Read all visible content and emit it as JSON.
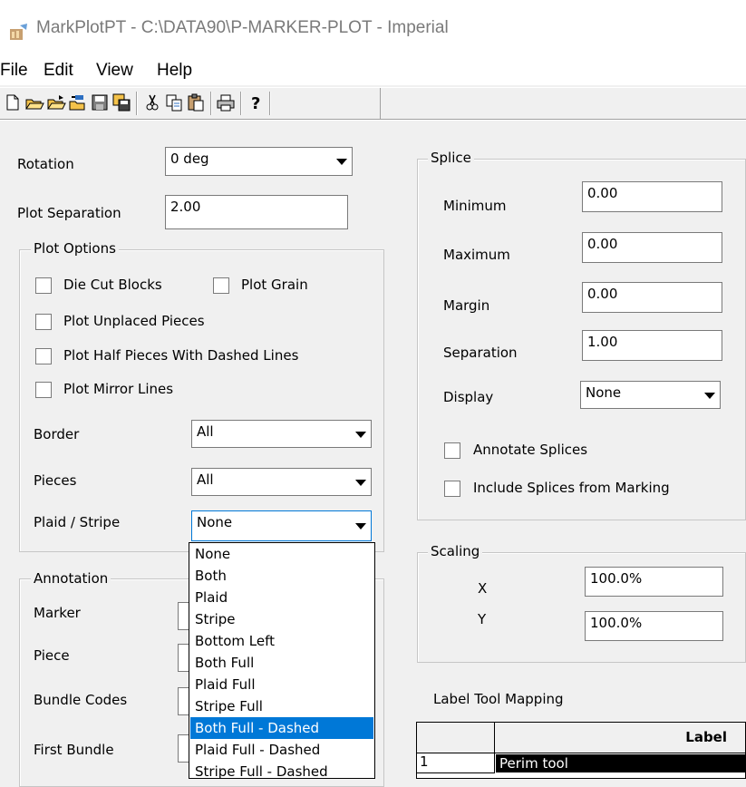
{
  "window": {
    "title": "MarkPlotPT - C:\\DATA90\\P-MARKER-PLOT - Imperial",
    "icon": "chart-app-icon"
  },
  "menu": [
    "File",
    "Edit",
    "View",
    "Help"
  ],
  "toolbar": {
    "buttons": [
      "new-icon",
      "open-icon",
      "open-folder-icon",
      "import-icon",
      "save-icon",
      "save-all-icon",
      "cut-icon",
      "copy-icon",
      "paste-icon",
      "print-icon",
      "help-icon"
    ]
  },
  "left": {
    "rotation_label": "Rotation",
    "rotation_value": "0 deg",
    "plot_separation_label": "Plot Separation",
    "plot_separation_value": "2.00",
    "plot_options": {
      "title": "Plot Options",
      "die_cut_blocks": "Die Cut Blocks",
      "plot_grain": "Plot Grain",
      "plot_unplaced": "Plot Unplaced Pieces",
      "plot_half": "Plot Half Pieces With Dashed Lines",
      "plot_mirror": "Plot Mirror Lines",
      "border_label": "Border",
      "border_value": "All",
      "pieces_label": "Pieces",
      "pieces_value": "All",
      "plaid_label": "Plaid / Stripe",
      "plaid_value": "None"
    },
    "annotation": {
      "title": "Annotation",
      "marker": "Marker",
      "piece": "Piece",
      "bundle_codes": "Bundle Codes",
      "first_bundle": "First Bundle"
    }
  },
  "dropdown": {
    "options": [
      "None",
      "Both",
      "Plaid",
      "Stripe",
      "Bottom Left",
      "Both Full",
      "Plaid Full",
      "Stripe Full",
      "Both Full - Dashed",
      "Plaid Full - Dashed",
      "Stripe Full - Dashed"
    ],
    "selected_index": 8
  },
  "splice": {
    "title": "Splice",
    "minimum_label": "Minimum",
    "minimum_value": "0.00",
    "maximum_label": "Maximum",
    "maximum_value": "0.00",
    "margin_label": "Margin",
    "margin_value": "0.00",
    "separation_label": "Separation",
    "separation_value": "1.00",
    "display_label": "Display",
    "display_value": "None",
    "annotate_splices": "Annotate Splices",
    "include_splices": "Include Splices from Marking"
  },
  "scaling": {
    "title": "Scaling",
    "x_label": "X",
    "x_value": "100.0%",
    "y_label": "Y",
    "y_value": "100.0%"
  },
  "label_tool": {
    "title": "Label Tool Mapping",
    "header_label": "Label",
    "rows": [
      {
        "num": "1",
        "label": "Perim tool"
      }
    ]
  },
  "colors": {
    "selection": "#0078d7",
    "window_bg": "#f0f0f0"
  }
}
